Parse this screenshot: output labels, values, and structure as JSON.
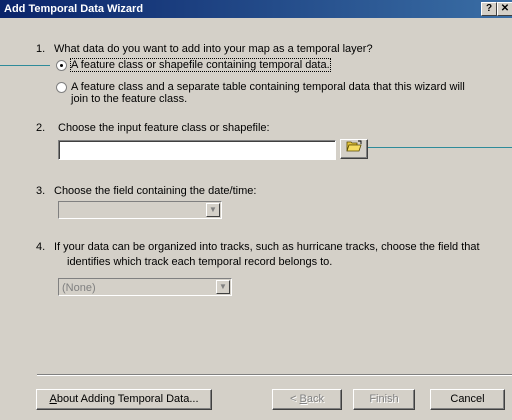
{
  "window": {
    "title": "Add Temporal Data Wizard",
    "help_button": "?",
    "close_button": "✕"
  },
  "q1": {
    "number": "1.",
    "question": "What data do you want to add into your map as a temporal layer?",
    "option1": "A feature class or shapefile containing temporal data.",
    "option2_line1": "A feature class and a separate table containing temporal data that this wizard will",
    "option2_line2": "join to the feature class."
  },
  "q2": {
    "number": "2.",
    "question": "Choose the input feature class or shapefile:",
    "input_value": ""
  },
  "q3": {
    "number": "3.",
    "question": "Choose the field containing the date/time:",
    "combo_value": ""
  },
  "q4": {
    "number": "4.",
    "question_line1": "If your data can be organized into tracks, such as hurricane tracks, choose the field that",
    "question_line2": "identifies which track each temporal record belongs to.",
    "combo_value": "(None)"
  },
  "buttons": {
    "about_prefix": "",
    "about_mnemonic": "A",
    "about_rest": "bout Adding Temporal Data...",
    "back_prefix": "< ",
    "back_mnemonic": "B",
    "back_rest": "ack",
    "finish": "Finish",
    "cancel": "Cancel"
  },
  "icons": {
    "folder": "open-folder-icon",
    "dropdown": "chevron-down-icon"
  },
  "colors": {
    "title_start": "#0a246a",
    "title_end": "#3a6ea5",
    "face": "#d4d0c8",
    "callout": "#2e8b9a"
  }
}
